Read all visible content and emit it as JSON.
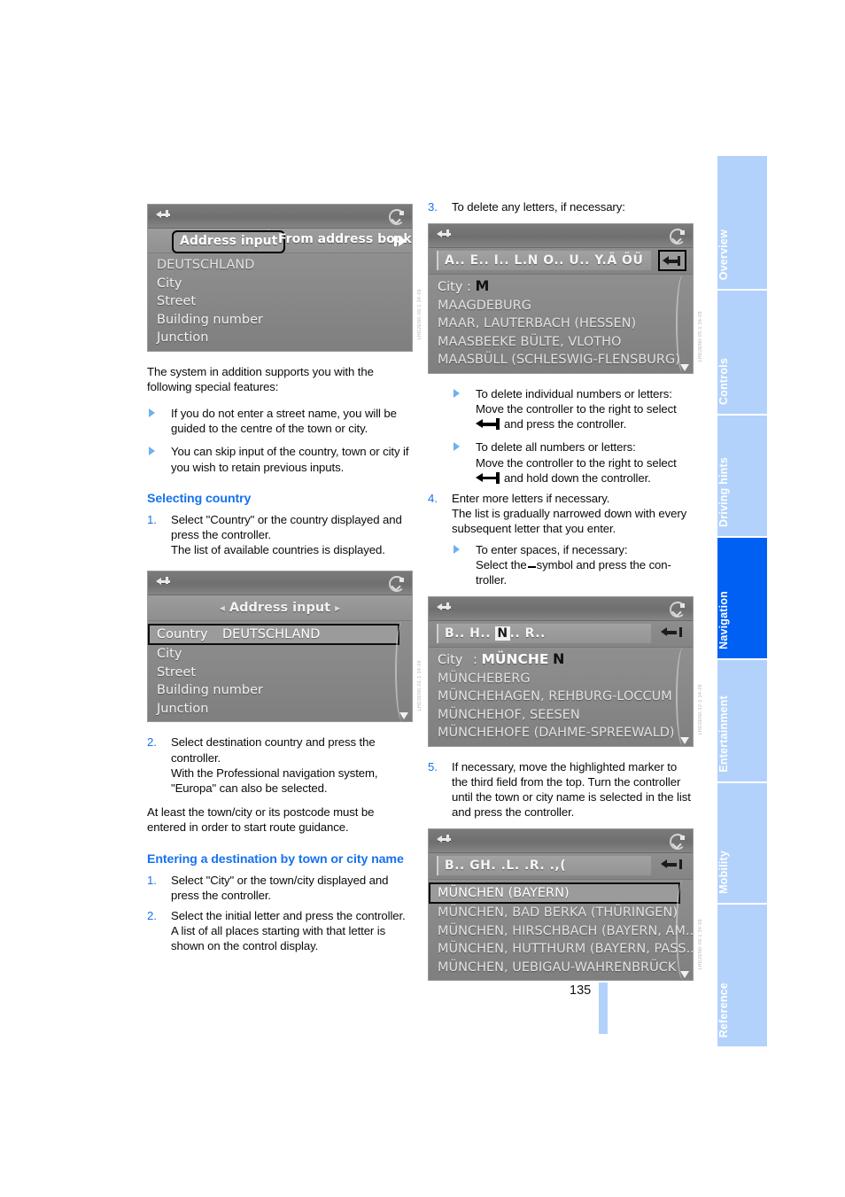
{
  "page": {
    "number": "135",
    "language": "en"
  },
  "sidebar": {
    "tabs": [
      {
        "label": "Overview",
        "active": false
      },
      {
        "label": "Controls",
        "active": false
      },
      {
        "label": "Driving hints",
        "active": false
      },
      {
        "label": "Navigation",
        "active": true
      },
      {
        "label": "Entertainment",
        "active": false
      },
      {
        "label": "Mobility",
        "active": false
      },
      {
        "label": "Reference",
        "active": false
      }
    ],
    "accent_active": "#0160f4",
    "accent_inactive": "#b3d2fb"
  },
  "left_column": {
    "screenshot_address_input": {
      "icons": {
        "back": "back-arrow-icon",
        "compass": "compass-icon"
      },
      "tab_selected": "Address input",
      "tab_other": "From address book",
      "rows": [
        "DEUTSCHLAND",
        "City",
        "Street",
        "Building number",
        "Junction"
      ],
      "image_code": "LHD2EN0-09-1 34-09"
    },
    "intro_paragraph": "The system in addition supports you with the following special features:",
    "bullets": [
      "If you do not enter a street name, you will be guided to the centre of the town or city.",
      "You can skip input of the country, town or city if you wish to retain previous inputs."
    ],
    "heading_selecting_country": "Selecting country",
    "steps_selecting_country": [
      {
        "num": "1.",
        "text": "Select \"Country\" or the country displayed and press the controller.\nThe list of available countries is displayed."
      }
    ],
    "screenshot_country": {
      "icons": {
        "back": "back-arrow-icon",
        "compass": "compass-icon"
      },
      "title": "Address input",
      "selected_row_label": "Country",
      "selected_row_value": "DEUTSCHLAND",
      "rows": [
        "City",
        "Street",
        "Building number",
        "Junction"
      ],
      "image_code": "LHD2EN0-01-1 34-09"
    },
    "steps_selecting_country_cont": [
      {
        "num": "2.",
        "text": "Select destination country and press the controller.\nWith the Professional navigation system, \"Europa\" can also be selected."
      }
    ],
    "paragraph_postcode": "At least the town/city or its postcode must be entered in order to start route guidance.",
    "heading_entering_destination": "Entering a destination by town or city name",
    "steps_entering_destination": [
      {
        "num": "1.",
        "text": "Select \"City\" or the town/city displayed and press the controller."
      },
      {
        "num": "2.",
        "text": "Select the initial letter and press the controller.\nA list of all places starting with that letter is shown on the control display."
      }
    ]
  },
  "right_column": {
    "step3": {
      "num": "3.",
      "text": "To delete any letters, if necessary:"
    },
    "screenshot_letters_m": {
      "icons": {
        "back": "back-arrow-icon",
        "compass": "compass-icon",
        "backspace": "backspace-icon"
      },
      "letter_strip": "A..  E..  I..  L.N O..  U..  Y.Ä ÖÜ",
      "field_label": "City :",
      "field_value": "M",
      "rows": [
        "MAAGDEBURG",
        "MAAR, LAUTERBACH (HESSEN)",
        "MAASBEEKE BÜLTE, VLOTHO",
        "MAASBÜLL (SCHLESWIG-FLENSBURG)"
      ],
      "image_code": "LHD2EN0-05-1 34-09"
    },
    "bullets_delete": [
      "To delete individual numbers or letters: Move the controller to the right to select ⌫ and press the controller.",
      "To delete all numbers or letters: Move the controller to the right to select ⌫ and hold down the controller."
    ],
    "bullet_delete_1_line1": "To delete individual numbers or letters:",
    "bullet_delete_1_line2": "Move the controller to the right to select",
    "bullet_delete_1_line3_tail": "and press the controller.",
    "bullet_delete_2_line1": "To delete all numbers or letters:",
    "bullet_delete_2_line2": "Move the controller to the right to select",
    "bullet_delete_2_line3_tail": "and hold down the controller.",
    "step4": {
      "num": "4.",
      "text": "Enter more letters if necessary.\nThe list is gradually narrowed down with every subsequent letter that you enter."
    },
    "bullet_spaces_line1": "To enter spaces, if necessary:",
    "bullet_spaces_line2_pre": "Select the",
    "bullet_spaces_line2_post": "symbol and press the con-",
    "bullet_spaces_line3": "troller.",
    "screenshot_muenche": {
      "icons": {
        "back": "back-arrow-icon",
        "compass": "compass-icon",
        "backspace": "backspace-icon"
      },
      "letter_strip_pre": "B..  H..  ",
      "letter_strip_highlight": "N",
      "letter_strip_post": "..  R..",
      "field_label": "City",
      "field_sep": ":",
      "field_value": "MÜNCHE",
      "field_value_next": "N",
      "rows": [
        "MÜNCHEBERG",
        "MÜNCHEHAGEN, REHBURG-LOCCUM",
        "MÜNCHEHOF, SEESEN",
        "MÜNCHEHOFE (DAHME-SPREEWALD)"
      ],
      "image_code": "LHD2EN0-12-1 34-09"
    },
    "step5": {
      "num": "5.",
      "text": "If necessary, move the highlighted marker to the third field from the top. Turn the controller until the town or city name is selected in the list and press the controller."
    },
    "screenshot_muenchen_list": {
      "icons": {
        "back": "back-arrow-icon",
        "compass": "compass-icon",
        "backspace": "backspace-icon"
      },
      "letter_strip": "B..  GH.  .L.  .R.  .,(",
      "selected_row": "MÜNCHEN (BAYERN)",
      "rows": [
        "MÜNCHEN, BAD BERKA (THÜRINGEN)",
        "MÜNCHEN, HIRSCHBACH (BAYERN, AM...",
        "MÜNCHEN, HUTTHURM (BAYERN, PASS...",
        "MÜNCHEN, UEBIGAU-WAHRENBRÜCK"
      ],
      "image_code": "LHD2EN0-09-1 34-09"
    }
  }
}
